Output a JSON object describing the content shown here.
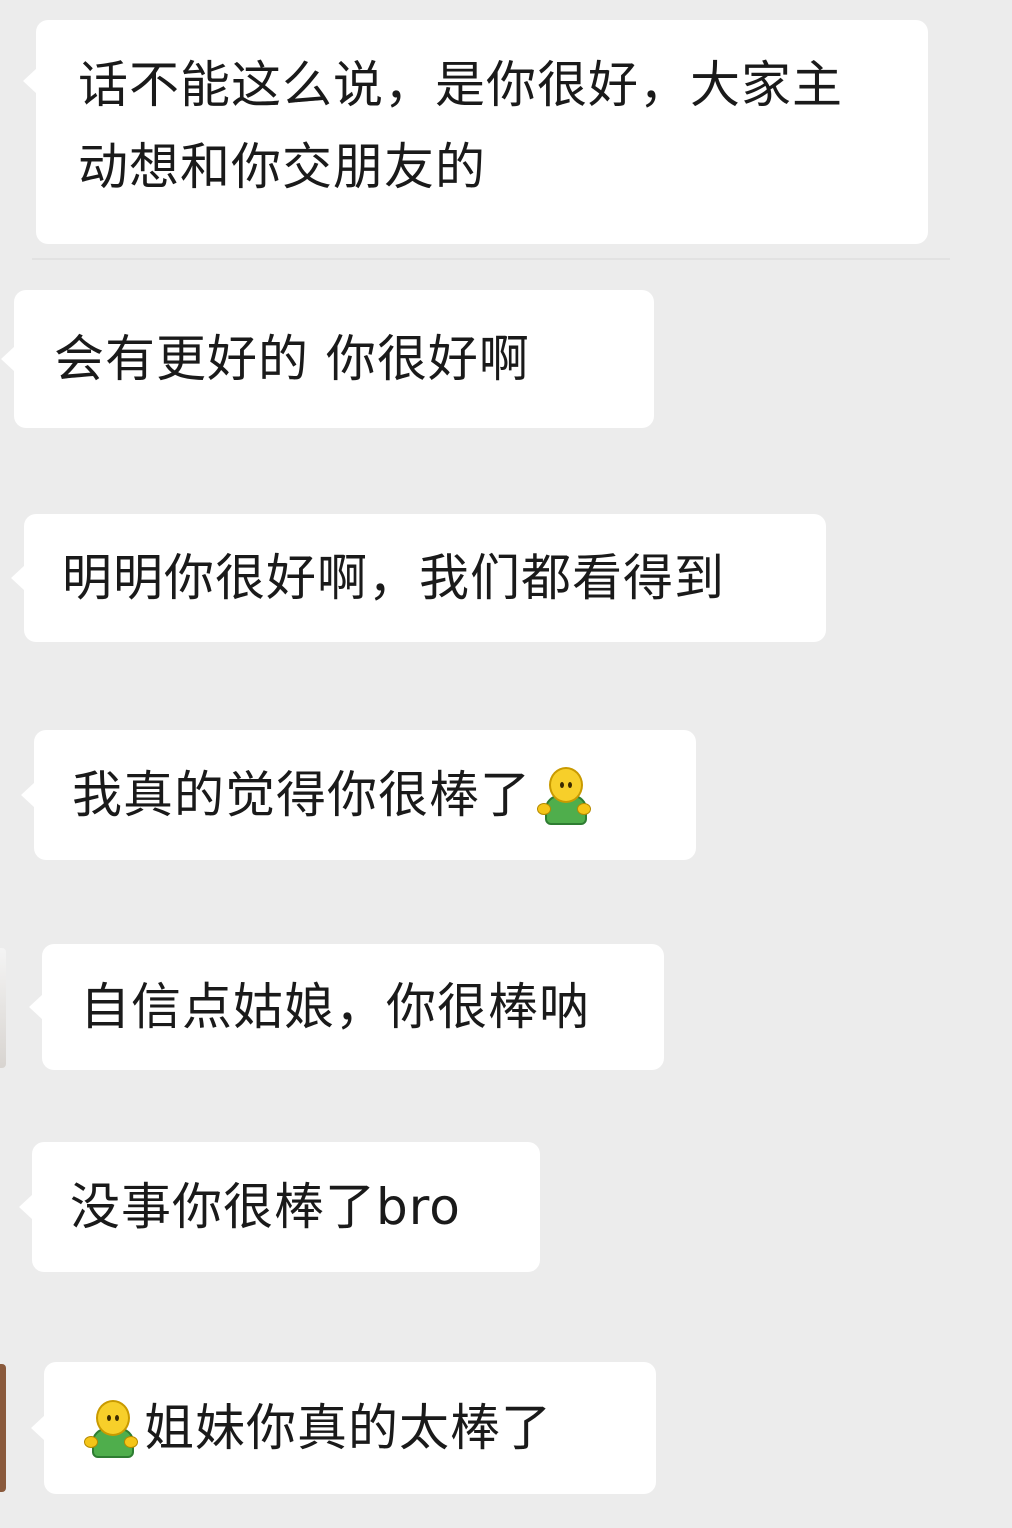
{
  "messages": [
    {
      "id": "m1",
      "text": "话不能这么说，是你很好，大家主动想和你交朋友的"
    },
    {
      "id": "m2",
      "text": "会有更好的 你很好啊"
    },
    {
      "id": "m3",
      "text": "明明你很好啊，我们都看得到"
    },
    {
      "id": "m4",
      "text": "我真的觉得你很棒了",
      "emoji_after": "person-shrugging-emoji"
    },
    {
      "id": "m5",
      "text": "自信点姑娘，你很棒呐"
    },
    {
      "id": "m6",
      "text": "没事你很棒了bro"
    },
    {
      "id": "m7",
      "emoji_before": "person-shrugging-emoji",
      "text": "姐妹你真的太棒了"
    }
  ],
  "colors": {
    "background": "#ececec",
    "bubble": "#ffffff",
    "text": "#1a1a1a",
    "emoji_body": "#4fae4c",
    "emoji_head": "#f7cf2a"
  }
}
